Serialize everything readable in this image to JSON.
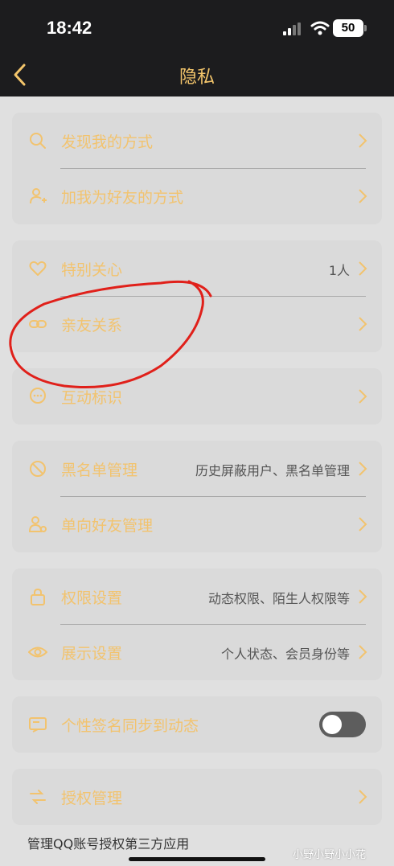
{
  "status_bar": {
    "time": "18:42",
    "battery": "50"
  },
  "header": {
    "title": "隐私"
  },
  "sections": [
    {
      "items": [
        {
          "label": "发现我的方式",
          "value": "",
          "icon": "search-icon"
        },
        {
          "label": "加我为好友的方式",
          "value": "",
          "icon": "add-user-icon"
        }
      ]
    },
    {
      "items": [
        {
          "label": "特别关心",
          "value": "1人",
          "icon": "heart-icon"
        },
        {
          "label": "亲友关系",
          "value": "",
          "icon": "link-icon"
        }
      ]
    },
    {
      "items": [
        {
          "label": "互动标识",
          "value": "",
          "icon": "chat-bubble-icon"
        }
      ]
    },
    {
      "items": [
        {
          "label": "黑名单管理",
          "value": "历史屏蔽用户、黑名单管理",
          "icon": "block-icon"
        },
        {
          "label": "单向好友管理",
          "value": "",
          "icon": "users-icon"
        }
      ]
    },
    {
      "items": [
        {
          "label": "权限设置",
          "value": "动态权限、陌生人权限等",
          "icon": "lock-icon"
        },
        {
          "label": "展示设置",
          "value": "个人状态、会员身份等",
          "icon": "eye-icon"
        }
      ]
    },
    {
      "items": [
        {
          "label": "个性签名同步到动态",
          "toggle": false,
          "icon": "signature-icon"
        }
      ]
    },
    {
      "items": [
        {
          "label": "授权管理",
          "value": "",
          "icon": "authorization-icon"
        }
      ]
    }
  ],
  "footnote": "管理QQ账号授权第三方应用",
  "watermark": "小野小野小小花",
  "colors": {
    "accent": "#f3c56b",
    "overlay": "#e0e0e0",
    "card": "#dadada",
    "status_bar": "#1c1c1e",
    "annotation": "#e0201a"
  }
}
